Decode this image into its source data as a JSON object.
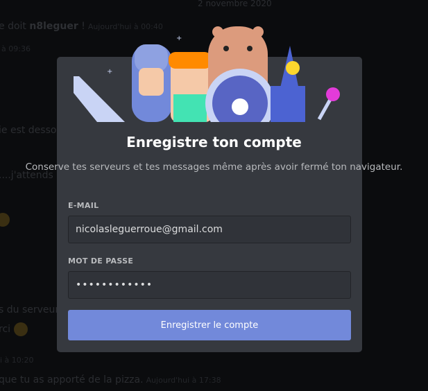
{
  "background_chat": {
    "date_divider": "2 novembre 2020",
    "lines": [
      {
        "text": "e doit ",
        "bold": "n8leguer",
        "after": " !",
        "time": "Aujourd'hui à 00:40"
      },
      {
        "time": "à 09:36"
      },
      {
        "text": "ie est dessou"
      },
      {
        "text": "....j'attends le"
      },
      {
        "text": "s du serveur("
      },
      {
        "text": "rci"
      },
      {
        "time": "i à 10:20"
      },
      {
        "text": "que tu as apporté de la pizza.",
        "time": "Aujourd'hui à 17:38"
      }
    ]
  },
  "modal": {
    "title": "Enregistre ton compte",
    "subtitle": "Conserve tes serveurs et tes messages même après avoir fermé ton navigateur.",
    "email_label": "E-MAIL",
    "email_value": "nicolasleguerroue@gmail.com",
    "password_label": "MOT DE PASSE",
    "password_value": "••••••••••••",
    "submit_label": "Enregistrer le compte"
  },
  "colors": {
    "accent": "#7289da",
    "modal_bg": "#36393f",
    "backdrop": "#0b0c0e"
  }
}
